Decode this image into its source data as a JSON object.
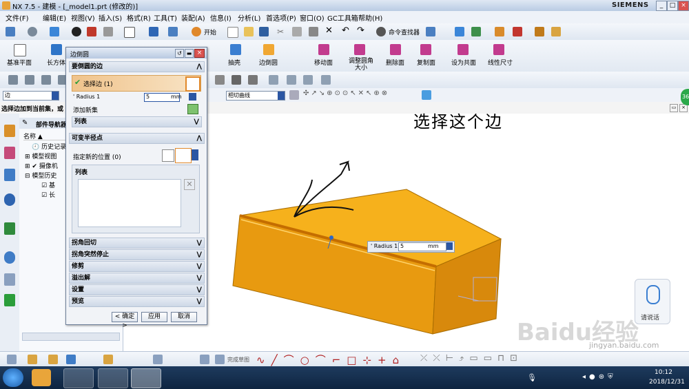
{
  "window": {
    "title": "NX 7.5 - 建模 - [_model1.prt (修改的)]",
    "brand": "SIEMENS"
  },
  "menu": [
    "文件(F)",
    "编辑(E)",
    "视图(V)",
    "插入(S)",
    "格式(R)",
    "工具(T)",
    "装配(A)",
    "信息(I)",
    "分析(L)",
    "首选项(P)",
    "窗口(O)",
    "GC工具箱",
    "帮助(H)"
  ],
  "toolbar1": {
    "start_label": "开始",
    "command_finder": "命令查找器"
  },
  "toolbar2": {
    "items": [
      "基准平面",
      "长方体",
      "抽壳",
      "边倒圆",
      "移动面",
      "调整圆角大小",
      "删除面",
      "复制面",
      "设为共面",
      "线性尺寸"
    ]
  },
  "selection_bar": {
    "filter_value": "边",
    "curve_rule": "相切曲线"
  },
  "status_text": "选择边加到当前集，或",
  "navigator": {
    "title": "部件导航器",
    "column_name": "名称",
    "items": [
      "历史记录",
      "模型视图",
      "摄像机",
      "模型历史",
      "基",
      "长"
    ]
  },
  "dialog": {
    "title": "边倒圆",
    "sections": {
      "edges": "要倒圆的边",
      "select_edge": "选择边 (1)",
      "radius_label": "Radius 1",
      "radius_value": "5",
      "radius_unit": "mm",
      "add_new_set": "添加新集",
      "list": "列表",
      "variable_radius": "可变半径点",
      "specify_location": "指定新的位置 (0)",
      "list2": "列表",
      "corner_setback": "拐角回切",
      "corner_stop": "拐角突然停止",
      "trim": "修剪",
      "overflow": "溢出解",
      "settings": "设置",
      "preview": "预览"
    },
    "buttons": {
      "ok": "< 确定 >",
      "apply": "应用",
      "cancel": "取消"
    }
  },
  "annotation": "选择这个边",
  "floating_radius": {
    "label": "Radius 1",
    "value": "5",
    "unit": "mm"
  },
  "voice": {
    "label": "请说话"
  },
  "bottom_toolbar": {
    "label": "完成草图"
  },
  "watermark": {
    "text": "Baidu经验",
    "url": "jingyan.baidu.com"
  },
  "clock": {
    "time": "10:12",
    "date": "2018/12/31"
  },
  "badge": {
    "value": "36"
  },
  "colors": {
    "accent": "#f3a60f",
    "box_top": "#f6b11c",
    "box_front": "#e89a10",
    "box_right": "#d8890c"
  }
}
